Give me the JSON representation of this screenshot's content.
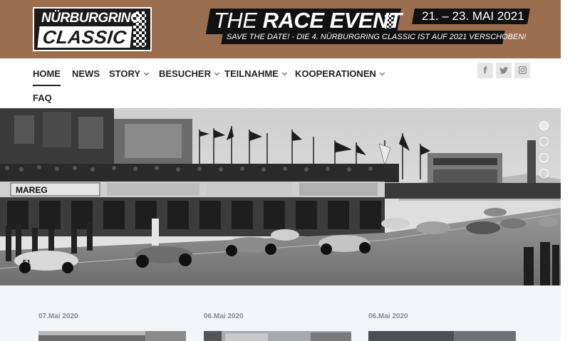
{
  "header": {
    "logo": {
      "line1": "NÜRBURGRING",
      "line2": "CLASSIC"
    },
    "race_title_light": "THE ",
    "race_title_bold": "RACE EVENT",
    "date": "21. – 23. MAI 2021",
    "subtitle": "SAVE THE DATE! - DIE 4. NÜRBURGRING CLASSIC IST AUF 2021 VERSCHOBEN!"
  },
  "nav": {
    "items": [
      {
        "label": "HOME",
        "active": true,
        "dropdown": false
      },
      {
        "label": "NEWS",
        "active": false,
        "dropdown": false
      },
      {
        "label": "STORY",
        "active": false,
        "dropdown": true
      },
      {
        "label": "BESUCHER",
        "active": false,
        "dropdown": true
      },
      {
        "label": "TEILNAHME",
        "active": false,
        "dropdown": true
      },
      {
        "label": "KOOPERATIONEN",
        "active": false,
        "dropdown": true
      },
      {
        "label": "FAQ",
        "active": false,
        "dropdown": false
      }
    ],
    "social": [
      {
        "icon": "facebook-icon",
        "glyph": "f"
      },
      {
        "icon": "twitter-icon",
        "glyph": "🐦"
      },
      {
        "icon": "instagram-icon",
        "glyph": "◙"
      }
    ]
  },
  "hero": {
    "dots": 4,
    "active_dot": 0,
    "signage": {
      "left": "MAREG"
    }
  },
  "news": {
    "posts": [
      {
        "date": "07.Mai 2020"
      },
      {
        "date": "06.Mai 2020"
      },
      {
        "date": "06.Mai 2020"
      }
    ]
  },
  "colors": {
    "header_bg": "#9b6e50",
    "nav_text": "#222222",
    "news_bg": "#f4f5f7"
  }
}
